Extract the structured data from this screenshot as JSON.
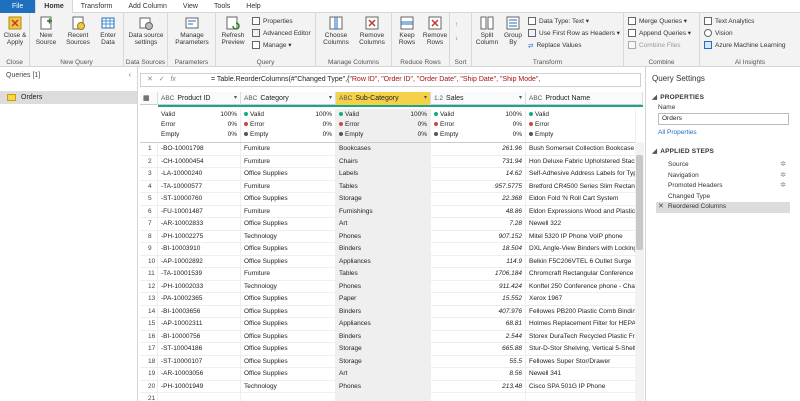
{
  "tabs": [
    "File",
    "Home",
    "Transform",
    "Add Column",
    "View",
    "Tools",
    "Help"
  ],
  "ribbon": {
    "close": {
      "label": "Close & Apply",
      "group": "Close"
    },
    "new_query": {
      "new_source": "New Source",
      "recent_sources": "Recent Sources",
      "enter_data": "Enter Data",
      "group": "New Query"
    },
    "data_sources": {
      "label": "Data source settings",
      "group": "Data Sources"
    },
    "parameters": {
      "label": "Manage Parameters",
      "group": "Parameters"
    },
    "query": {
      "refresh": "Refresh Preview",
      "properties": "Properties",
      "advanced_editor": "Advanced Editor",
      "manage": "Manage",
      "group": "Query"
    },
    "manage_columns": {
      "choose": "Choose Columns",
      "remove": "Remove Columns",
      "group": "Manage Columns"
    },
    "reduce_rows": {
      "keep": "Keep Rows",
      "remove": "Remove Rows",
      "group": "Reduce Rows"
    },
    "sort": {
      "group": "Sort"
    },
    "transform": {
      "split": "Split Column",
      "group_by": "Group By",
      "data_type": "Data Type: Text",
      "first_row": "Use First Row as Headers",
      "replace": "Replace Values",
      "group": "Transform"
    },
    "combine": {
      "merge": "Merge Queries",
      "append": "Append Queries",
      "combine_files": "Combine Files",
      "group": "Combine"
    },
    "ai": {
      "text": "Text Analytics",
      "vision": "Vision",
      "azure": "Azure Machine Learning",
      "group": "AI Insights"
    }
  },
  "queries": {
    "header": "Queries [1]",
    "items": [
      "Orders"
    ]
  },
  "formula": {
    "prefix": "= Table.ReorderColumns(#\"Changed Type\",{",
    "args": "\"Row ID\", \"Order ID\", \"Order Date\", \"Ship Date\", \"Ship Mode\","
  },
  "columns": [
    {
      "type": "ABC",
      "name": "Product ID"
    },
    {
      "type": "ABC",
      "name": "Category"
    },
    {
      "type": "ABC",
      "name": "Sub-Category"
    },
    {
      "type": "1.2",
      "name": "Sales"
    },
    {
      "type": "ABC",
      "name": "Product Name"
    }
  ],
  "profile": {
    "first": [
      [
        "Valid",
        "100%"
      ],
      [
        "Error",
        "0%"
      ],
      [
        "Empty",
        "0%"
      ]
    ],
    "labels": [
      "Valid",
      "Error",
      "Empty"
    ],
    "values": [
      "100%",
      "0%",
      "0%"
    ]
  },
  "rows": [
    [
      "1",
      "-BO-10001798",
      "Furniture",
      "Bookcases",
      "261.96",
      "Bush Somerset Collection Bookcase"
    ],
    [
      "2",
      "-CH-10000454",
      "Furniture",
      "Chairs",
      "731.94",
      "Hon Deluxe Fabric Upholstered Stack"
    ],
    [
      "3",
      "-LA-10000240",
      "Office Supplies",
      "Labels",
      "14.62",
      "Self-Adhesive Address Labels for Type"
    ],
    [
      "4",
      "-TA-10000577",
      "Furniture",
      "Tables",
      "957.5775",
      "Bretford CR4500 Series Slim Rectang"
    ],
    [
      "5",
      "-ST-10000760",
      "Office Supplies",
      "Storage",
      "22.368",
      "Eldon Fold 'N Roll Cart System"
    ],
    [
      "6",
      "-FU-10001487",
      "Furniture",
      "Furnishings",
      "48.86",
      "Eldon Expressions Wood and Plastic D"
    ],
    [
      "7",
      "-AR-10002833",
      "Office Supplies",
      "Art",
      "7.28",
      "Newell 322"
    ],
    [
      "8",
      "-PH-10002275",
      "Technology",
      "Phones",
      "907.152",
      "Mitel 5320 IP Phone VoIP phone"
    ],
    [
      "9",
      "-BI-10003910",
      "Office Supplies",
      "Binders",
      "18.504",
      "DXL Angle-View Binders with Locking"
    ],
    [
      "10",
      "-AP-10002892",
      "Office Supplies",
      "Appliances",
      "114.9",
      "Belkin F5C206VTEL 6 Outlet Surge"
    ],
    [
      "11",
      "-TA-10001539",
      "Furniture",
      "Tables",
      "1706.184",
      "Chromcraft Rectangular Conference T"
    ],
    [
      "12",
      "-PH-10002033",
      "Technology",
      "Phones",
      "911.424",
      "Konftel 250 Conference phone - Char"
    ],
    [
      "13",
      "-PA-10002365",
      "Office Supplies",
      "Paper",
      "15.552",
      "Xerox 1967"
    ],
    [
      "14",
      "-BI-10003656",
      "Office Supplies",
      "Binders",
      "407.976",
      "Fellowes PB200 Plastic Comb Binding"
    ],
    [
      "15",
      "-AP-10002311",
      "Office Supplies",
      "Appliances",
      "68.81",
      "Holmes Replacement Filter for HEPA"
    ],
    [
      "16",
      "-BI-10000756",
      "Office Supplies",
      "Binders",
      "2.544",
      "Storex DuraTech Recycled Plastic Fro"
    ],
    [
      "17",
      "-ST-10004186",
      "Office Supplies",
      "Storage",
      "665.88",
      "Stur-D-Stor Shelving, Vertical 5-Shelf"
    ],
    [
      "18",
      "-ST-10000107",
      "Office Supplies",
      "Storage",
      "55.5",
      "Fellowes Super Stor/Drawer"
    ],
    [
      "19",
      "-AR-10003056",
      "Office Supplies",
      "Art",
      "8.56",
      "Newell 341"
    ],
    [
      "20",
      "-PH-10001949",
      "Technology",
      "Phones",
      "213.48",
      "Cisco SPA 501G IP Phone"
    ],
    [
      "21",
      "",
      "",
      "",
      "",
      ""
    ]
  ],
  "settings": {
    "title": "Query Settings",
    "properties": "PROPERTIES",
    "name_label": "Name",
    "name_value": "Orders",
    "all_properties": "All Properties",
    "applied_steps": "APPLIED STEPS",
    "steps": [
      "Source",
      "Navigation",
      "Promoted Headers",
      "Changed Type",
      "Reordered Columns"
    ]
  },
  "colors": {
    "accent": "#1f6fbf",
    "selected_header": "#f5d14a",
    "quality_bar": "#1aa688",
    "valid": "#1aa688",
    "error": "#d0473c",
    "empty": "#555555"
  }
}
